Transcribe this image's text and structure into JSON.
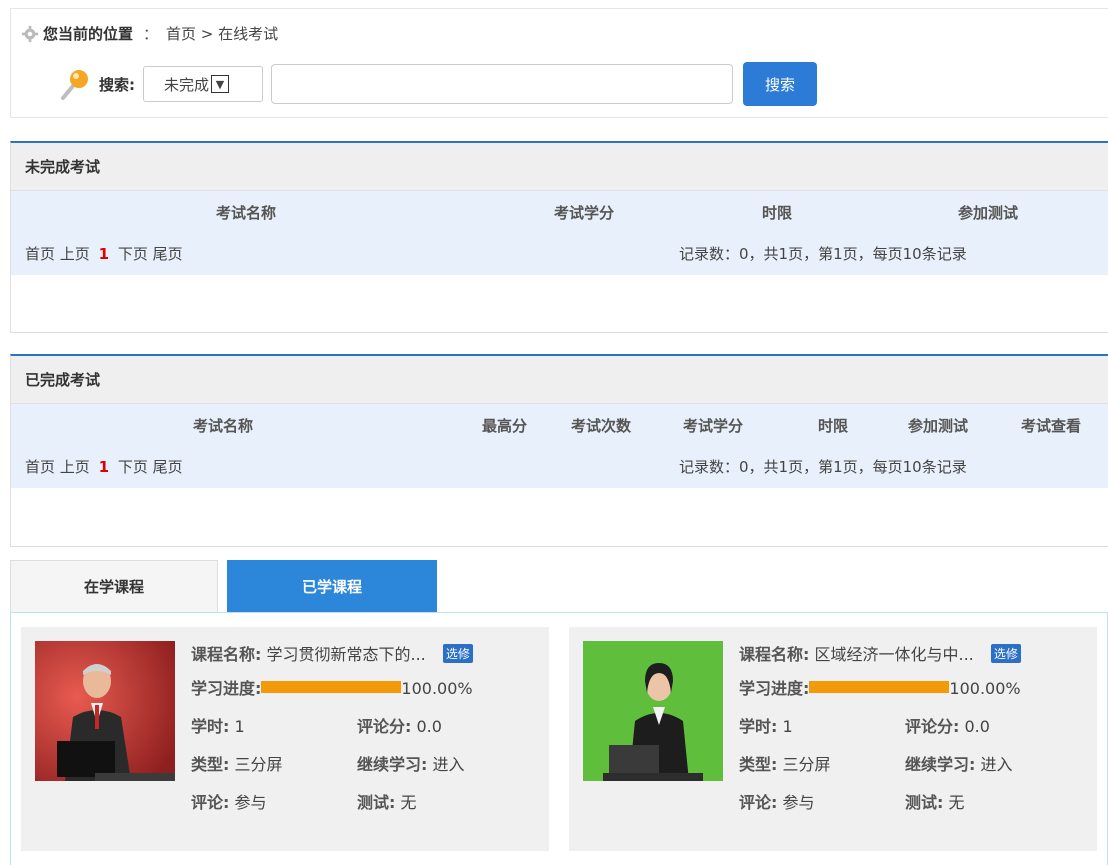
{
  "breadcrumb": {
    "label": "您当前的位置",
    "separator": "：",
    "path": "首页 > 在线考试"
  },
  "search": {
    "label": "搜索:",
    "select_value": "未完成",
    "input_value": "",
    "button_label": "搜索"
  },
  "unfinished": {
    "title": "未完成考试",
    "columns": [
      "考试名称",
      "考试学分",
      "时限",
      "参加测试"
    ],
    "pager": {
      "first": "首页",
      "prev": "上页",
      "current": "1",
      "next": "下页",
      "last": "尾页"
    },
    "records_info": "记录数：0，共1页，第1页，每页10条记录"
  },
  "finished": {
    "title": "已完成考试",
    "columns": [
      "考试名称",
      "最高分",
      "考试次数",
      "考试学分",
      "时限",
      "参加测试",
      "考试查看"
    ],
    "pager": {
      "first": "首页",
      "prev": "上页",
      "current": "1",
      "next": "下页",
      "last": "尾页"
    },
    "records_info": "记录数：0，共1页，第1页，每页10条记录"
  },
  "tabs": [
    {
      "label": "在学课程",
      "active": false
    },
    {
      "label": "已学课程",
      "active": true
    }
  ],
  "courses": [
    {
      "name_label": "课程名称:",
      "name": "学习贯彻新常态下的...",
      "badge": "选修",
      "progress_label": "学习进度:",
      "progress": 1.0,
      "progress_text": "100.00%",
      "hours_label": "学时:",
      "hours": "1",
      "score_label": "评论分:",
      "score": "0.0",
      "type_label": "类型:",
      "type": "三分屏",
      "continue_label": "继续学习:",
      "continue": "进入",
      "comment_label": "评论:",
      "comment": "参与",
      "test_label": "测试:",
      "test": "无"
    },
    {
      "name_label": "课程名称:",
      "name": "区域经济一体化与中...",
      "badge": "选修",
      "progress_label": "学习进度:",
      "progress": 1.0,
      "progress_text": "100.00%",
      "hours_label": "学时:",
      "hours": "1",
      "score_label": "评论分:",
      "score": "0.0",
      "type_label": "类型:",
      "type": "三分屏",
      "continue_label": "继续学习:",
      "continue": "进入",
      "comment_label": "评论:",
      "comment": "参与",
      "test_label": "测试:",
      "test": "无"
    }
  ],
  "colors": {
    "accent": "#2c86d9",
    "panel_border": "#2f72c3",
    "progress": "#f39a0b",
    "current_page": "#e00000"
  }
}
